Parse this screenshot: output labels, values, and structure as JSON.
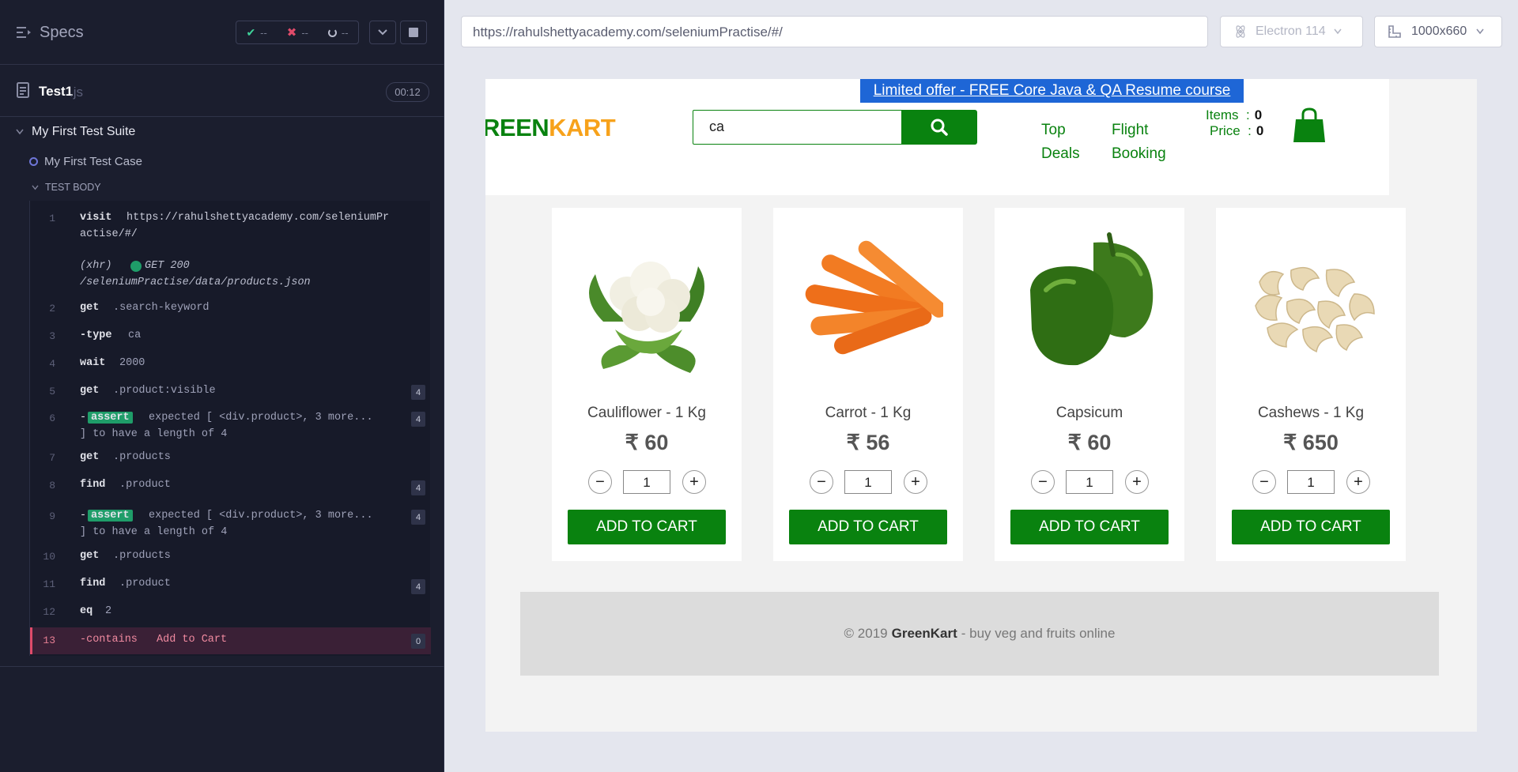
{
  "reporter": {
    "title": "Specs",
    "stats": {
      "passed": "--",
      "failed": "--",
      "pending": "--"
    },
    "spec": {
      "name": "Test1",
      "ext": ".js",
      "time": "00:12"
    },
    "suite": "My First Test Suite",
    "test_case": "My First Test Case",
    "test_body": "TEST BODY",
    "commands": [
      {
        "num": "1",
        "name": "visit",
        "msg": "https://rahulshettyacademy.com/seleniumPr",
        "msg2": "actise/#/"
      },
      {
        "num": "",
        "name": "(xhr)",
        "msg": "GET 200",
        "msg2": "/seleniumPractise/data/products.json"
      },
      {
        "num": "2",
        "name": "get",
        "msg": ".search-keyword"
      },
      {
        "num": "3",
        "name": "-type",
        "msg": "ca"
      },
      {
        "num": "4",
        "name": "wait",
        "msg": "2000"
      },
      {
        "num": "5",
        "name": "get",
        "msg": ".product:visible",
        "badge": "4"
      },
      {
        "num": "6",
        "name": "-",
        "tag": "assert",
        "msg": "expected [ <div.product>, 3 more...",
        "msg2": "] to have a length of 4",
        "badge": "4"
      },
      {
        "num": "7",
        "name": "get",
        "msg": ".products"
      },
      {
        "num": "8",
        "name": "find",
        "msg": ".product",
        "badge": "4"
      },
      {
        "num": "9",
        "name": "-",
        "tag": "assert",
        "msg": "expected [ <div.product>, 3 more...",
        "msg2": "] to have a length of 4",
        "badge": "4"
      },
      {
        "num": "10",
        "name": "get",
        "msg": ".products"
      },
      {
        "num": "11",
        "name": "find",
        "msg": ".product",
        "badge": "4"
      },
      {
        "num": "12",
        "name": "eq",
        "msg": "2"
      },
      {
        "num": "13",
        "name": "-contains",
        "msg": "Add to Cart",
        "badge": "0"
      }
    ]
  },
  "browser": {
    "url": "https://rahulshettyacademy.com/seleniumPractise/#/",
    "engine": "Electron 114",
    "viewport": "1000x660"
  },
  "site": {
    "offer": "Limited offer - FREE Core Java & QA Resume course",
    "logo_green": "REEN",
    "logo_orange": "KART",
    "search_value": "ca",
    "nav": {
      "top_deals_1": "Top",
      "top_deals_2": "Deals",
      "flight_1": "Flight",
      "flight_2": "Booking"
    },
    "cart": {
      "items_label": "Items",
      "items_value": "0",
      "price_label": "Price",
      "price_value": "0"
    },
    "products": [
      {
        "name": "Cauliflower - 1 Kg",
        "price": "₹ 60",
        "qty": "1",
        "button": "ADD TO CART"
      },
      {
        "name": "Carrot - 1 Kg",
        "price": "₹ 56",
        "qty": "1",
        "button": "ADD TO CART"
      },
      {
        "name": "Capsicum",
        "price": "₹ 60",
        "qty": "1",
        "button": "ADD TO CART"
      },
      {
        "name": "Cashews - 1 Kg",
        "price": "₹ 650",
        "qty": "1",
        "button": "ADD TO CART"
      }
    ],
    "footer": {
      "prefix": "© 2019",
      "brand": "GreenKart",
      "suffix": "- buy veg and fruits online"
    }
  },
  "colors": {
    "brand_green": "#09820f",
    "brand_orange": "#f7a21b",
    "offer_blue": "#1e66d6",
    "reporter_bg": "#1b1e2e",
    "fail_red": "#e04b6a"
  }
}
